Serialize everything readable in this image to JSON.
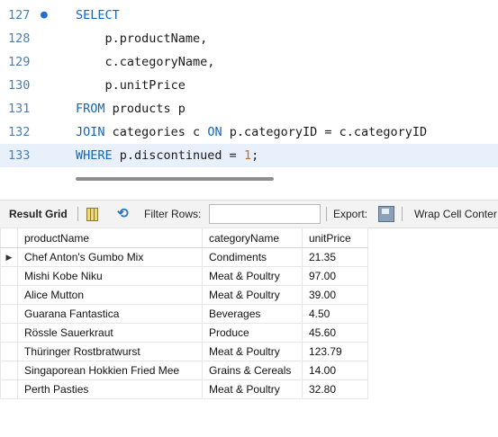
{
  "editor": {
    "lines": [
      {
        "num": "127",
        "marker": "●",
        "text": "SELECT"
      },
      {
        "num": "128",
        "text": "    p.productName,"
      },
      {
        "num": "129",
        "text": "    c.categoryName,"
      },
      {
        "num": "130",
        "text": "    p.unitPrice"
      },
      {
        "num": "131",
        "kw": "FROM",
        "rest": " products p"
      },
      {
        "num": "132",
        "kw": "JOIN",
        "rest1": " categories c ",
        "kw2": "ON",
        "rest2": " p.categoryID = c.categoryID"
      },
      {
        "num": "133",
        "kw": "WHERE",
        "rest1": " p.discontinued = ",
        "value": "1",
        "rest2": ";"
      }
    ]
  },
  "toolbar": {
    "result_grid_label": "Result Grid",
    "filter_label": "Filter Rows:",
    "filter_value": "",
    "export_label": "Export:",
    "wrap_label": "Wrap Cell Conter"
  },
  "grid": {
    "columns": [
      "productName",
      "categoryName",
      "unitPrice"
    ],
    "row_marker": "▶",
    "rows": [
      [
        "Chef Anton's Gumbo Mix",
        "Condiments",
        "21.35"
      ],
      [
        "Mishi Kobe Niku",
        "Meat & Poultry",
        "97.00"
      ],
      [
        "Alice Mutton",
        "Meat & Poultry",
        "39.00"
      ],
      [
        "Guarana Fantastica",
        "Beverages",
        "4.50"
      ],
      [
        "Rössle Sauerkraut",
        "Produce",
        "45.60"
      ],
      [
        "Thüringer Rostbratwurst",
        "Meat & Poultry",
        "123.79"
      ],
      [
        "Singaporean Hokkien Fried Mee",
        "Grains & Cereals",
        "14.00"
      ],
      [
        "Perth Pasties",
        "Meat & Poultry",
        "32.80"
      ]
    ]
  }
}
